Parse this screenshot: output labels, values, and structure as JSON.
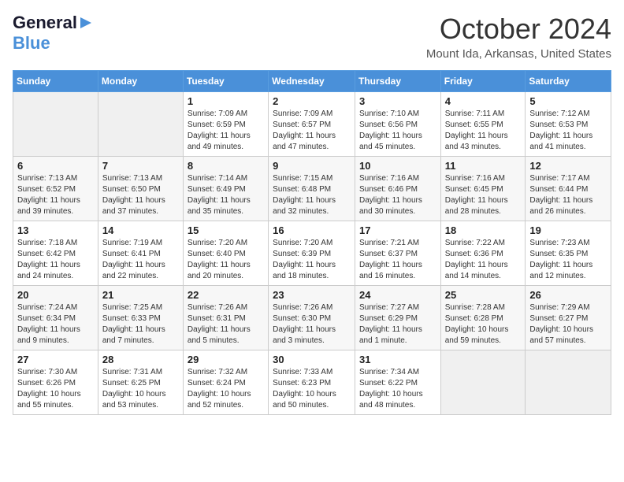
{
  "logo": {
    "line1": "General",
    "arrow": "▶",
    "line2": "Blue"
  },
  "title": "October 2024",
  "location": "Mount Ida, Arkansas, United States",
  "days_of_week": [
    "Sunday",
    "Monday",
    "Tuesday",
    "Wednesday",
    "Thursday",
    "Friday",
    "Saturday"
  ],
  "weeks": [
    [
      {
        "num": "",
        "info": ""
      },
      {
        "num": "",
        "info": ""
      },
      {
        "num": "1",
        "info": "Sunrise: 7:09 AM\nSunset: 6:59 PM\nDaylight: 11 hours and 49 minutes."
      },
      {
        "num": "2",
        "info": "Sunrise: 7:09 AM\nSunset: 6:57 PM\nDaylight: 11 hours and 47 minutes."
      },
      {
        "num": "3",
        "info": "Sunrise: 7:10 AM\nSunset: 6:56 PM\nDaylight: 11 hours and 45 minutes."
      },
      {
        "num": "4",
        "info": "Sunrise: 7:11 AM\nSunset: 6:55 PM\nDaylight: 11 hours and 43 minutes."
      },
      {
        "num": "5",
        "info": "Sunrise: 7:12 AM\nSunset: 6:53 PM\nDaylight: 11 hours and 41 minutes."
      }
    ],
    [
      {
        "num": "6",
        "info": "Sunrise: 7:13 AM\nSunset: 6:52 PM\nDaylight: 11 hours and 39 minutes."
      },
      {
        "num": "7",
        "info": "Sunrise: 7:13 AM\nSunset: 6:50 PM\nDaylight: 11 hours and 37 minutes."
      },
      {
        "num": "8",
        "info": "Sunrise: 7:14 AM\nSunset: 6:49 PM\nDaylight: 11 hours and 35 minutes."
      },
      {
        "num": "9",
        "info": "Sunrise: 7:15 AM\nSunset: 6:48 PM\nDaylight: 11 hours and 32 minutes."
      },
      {
        "num": "10",
        "info": "Sunrise: 7:16 AM\nSunset: 6:46 PM\nDaylight: 11 hours and 30 minutes."
      },
      {
        "num": "11",
        "info": "Sunrise: 7:16 AM\nSunset: 6:45 PM\nDaylight: 11 hours and 28 minutes."
      },
      {
        "num": "12",
        "info": "Sunrise: 7:17 AM\nSunset: 6:44 PM\nDaylight: 11 hours and 26 minutes."
      }
    ],
    [
      {
        "num": "13",
        "info": "Sunrise: 7:18 AM\nSunset: 6:42 PM\nDaylight: 11 hours and 24 minutes."
      },
      {
        "num": "14",
        "info": "Sunrise: 7:19 AM\nSunset: 6:41 PM\nDaylight: 11 hours and 22 minutes."
      },
      {
        "num": "15",
        "info": "Sunrise: 7:20 AM\nSunset: 6:40 PM\nDaylight: 11 hours and 20 minutes."
      },
      {
        "num": "16",
        "info": "Sunrise: 7:20 AM\nSunset: 6:39 PM\nDaylight: 11 hours and 18 minutes."
      },
      {
        "num": "17",
        "info": "Sunrise: 7:21 AM\nSunset: 6:37 PM\nDaylight: 11 hours and 16 minutes."
      },
      {
        "num": "18",
        "info": "Sunrise: 7:22 AM\nSunset: 6:36 PM\nDaylight: 11 hours and 14 minutes."
      },
      {
        "num": "19",
        "info": "Sunrise: 7:23 AM\nSunset: 6:35 PM\nDaylight: 11 hours and 12 minutes."
      }
    ],
    [
      {
        "num": "20",
        "info": "Sunrise: 7:24 AM\nSunset: 6:34 PM\nDaylight: 11 hours and 9 minutes."
      },
      {
        "num": "21",
        "info": "Sunrise: 7:25 AM\nSunset: 6:33 PM\nDaylight: 11 hours and 7 minutes."
      },
      {
        "num": "22",
        "info": "Sunrise: 7:26 AM\nSunset: 6:31 PM\nDaylight: 11 hours and 5 minutes."
      },
      {
        "num": "23",
        "info": "Sunrise: 7:26 AM\nSunset: 6:30 PM\nDaylight: 11 hours and 3 minutes."
      },
      {
        "num": "24",
        "info": "Sunrise: 7:27 AM\nSunset: 6:29 PM\nDaylight: 11 hours and 1 minute."
      },
      {
        "num": "25",
        "info": "Sunrise: 7:28 AM\nSunset: 6:28 PM\nDaylight: 10 hours and 59 minutes."
      },
      {
        "num": "26",
        "info": "Sunrise: 7:29 AM\nSunset: 6:27 PM\nDaylight: 10 hours and 57 minutes."
      }
    ],
    [
      {
        "num": "27",
        "info": "Sunrise: 7:30 AM\nSunset: 6:26 PM\nDaylight: 10 hours and 55 minutes."
      },
      {
        "num": "28",
        "info": "Sunrise: 7:31 AM\nSunset: 6:25 PM\nDaylight: 10 hours and 53 minutes."
      },
      {
        "num": "29",
        "info": "Sunrise: 7:32 AM\nSunset: 6:24 PM\nDaylight: 10 hours and 52 minutes."
      },
      {
        "num": "30",
        "info": "Sunrise: 7:33 AM\nSunset: 6:23 PM\nDaylight: 10 hours and 50 minutes."
      },
      {
        "num": "31",
        "info": "Sunrise: 7:34 AM\nSunset: 6:22 PM\nDaylight: 10 hours and 48 minutes."
      },
      {
        "num": "",
        "info": ""
      },
      {
        "num": "",
        "info": ""
      }
    ]
  ]
}
